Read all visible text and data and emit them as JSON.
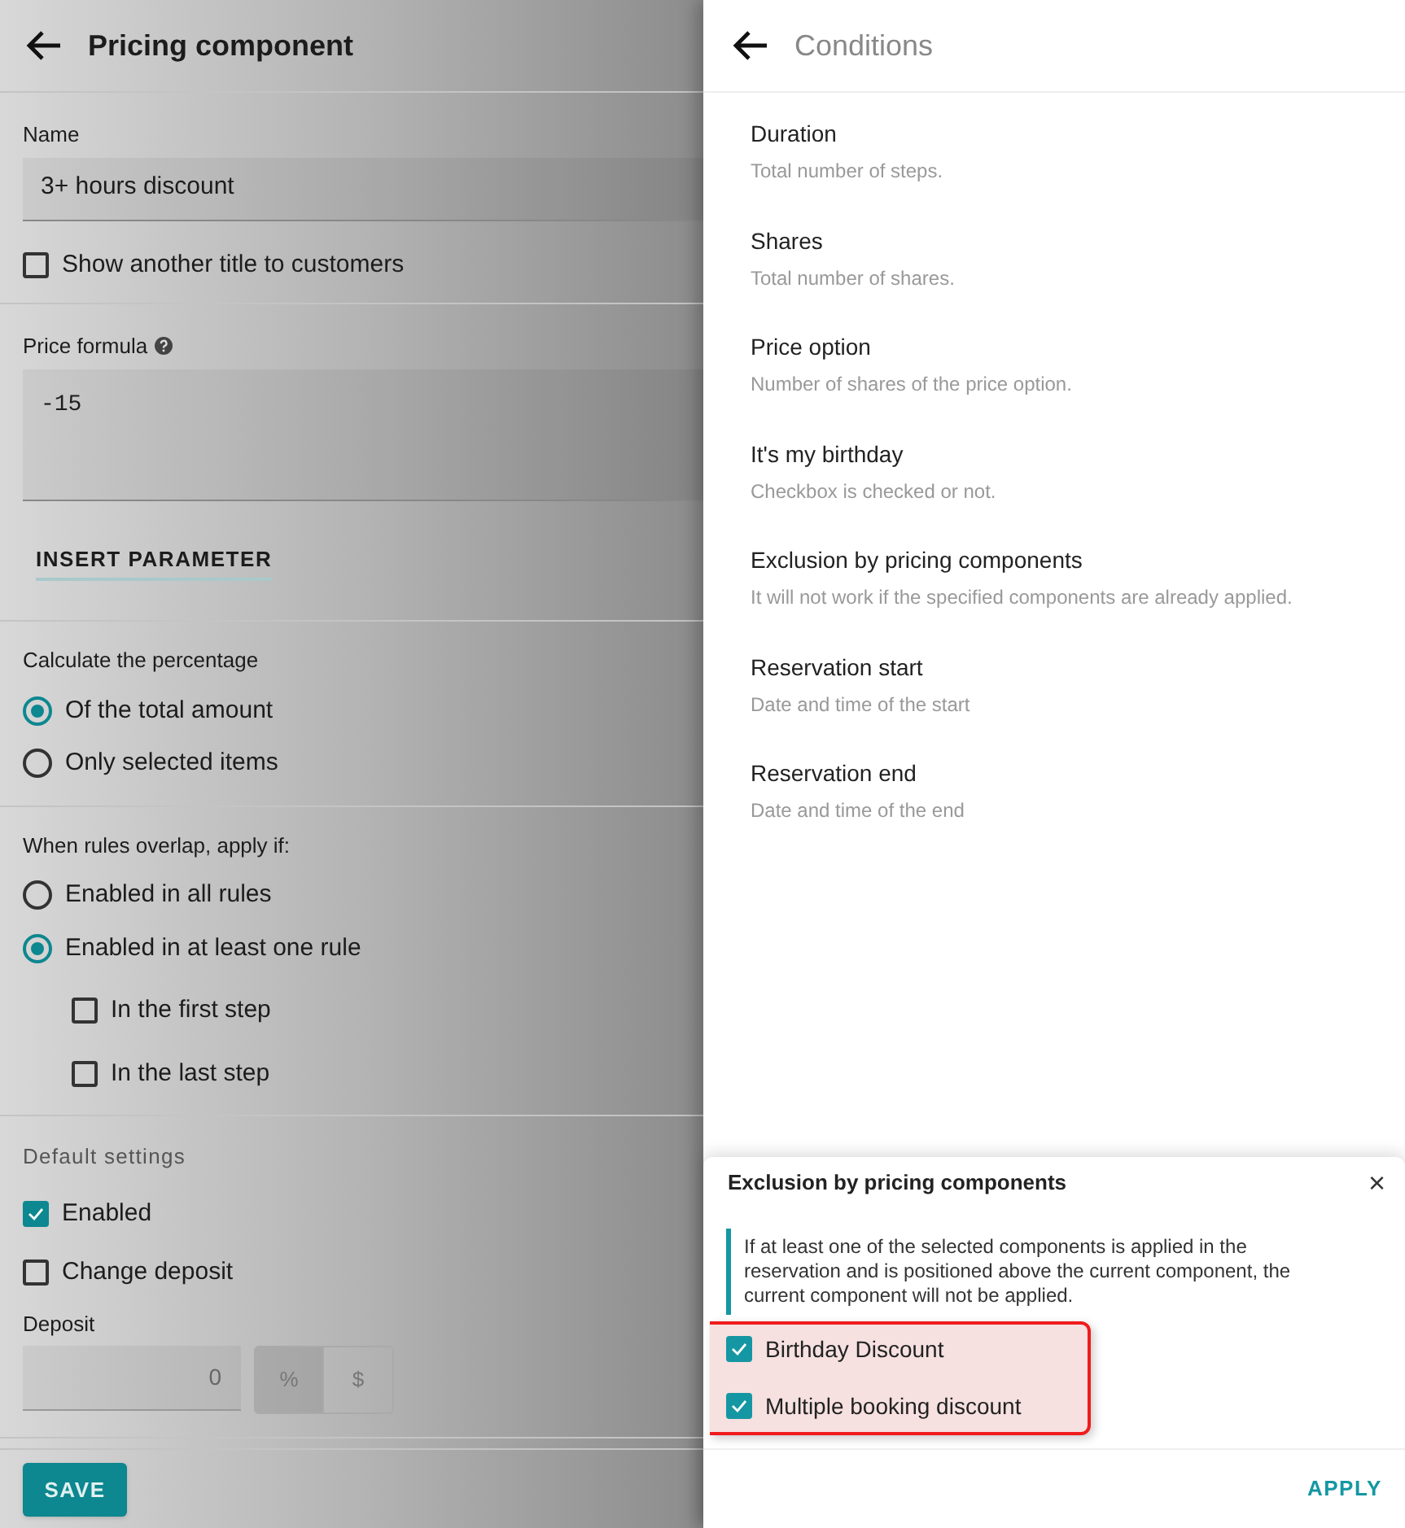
{
  "form": {
    "title": "Pricing component",
    "name_label": "Name",
    "name_value": "3+ hours discount",
    "alt_title": {
      "label": "Show another title to customers",
      "checked": false
    },
    "formula_label": "Price formula",
    "formula_value": "-15",
    "insert_button": "INSERT PARAMETER",
    "percentage": {
      "label": "Calculate the percentage",
      "options": [
        {
          "label": "Of the total amount",
          "selected": true
        },
        {
          "label": "Only selected items",
          "selected": false
        }
      ]
    },
    "overlap": {
      "label": "When rules overlap, apply if:",
      "options": [
        {
          "label": "Enabled in all rules",
          "selected": false
        },
        {
          "label": "Enabled in at least one rule",
          "selected": true
        }
      ],
      "steps": [
        {
          "label": "In the first step",
          "checked": false
        },
        {
          "label": "In the last step",
          "checked": false
        }
      ]
    },
    "defaults": {
      "heading": "Default settings",
      "checks": [
        {
          "label": "Enabled",
          "checked": true
        },
        {
          "label": "Change deposit",
          "checked": false
        }
      ],
      "deposit_label": "Deposit",
      "deposit_value": "0",
      "units": [
        {
          "label": "%",
          "selected": true
        },
        {
          "label": "$",
          "selected": false
        }
      ]
    },
    "save": "SAVE"
  },
  "conditions": {
    "title": "Conditions",
    "items": [
      {
        "title": "Duration",
        "subtitle": "Total number of steps."
      },
      {
        "title": "Shares",
        "subtitle": "Total number of shares."
      },
      {
        "title": "Price option",
        "subtitle": "Number of shares of the price option."
      },
      {
        "title": "It's my birthday",
        "subtitle": "Checkbox is checked or not."
      },
      {
        "title": "Exclusion by pricing components",
        "subtitle": "It will not work if the specified components are already applied."
      },
      {
        "title": "Reservation start",
        "subtitle": "Date and time of the start"
      },
      {
        "title": "Reservation end",
        "subtitle": "Date and time of the end"
      }
    ]
  },
  "dialog": {
    "title": "Exclusion by pricing components",
    "close": "×",
    "note": "If at least one of the selected components is applied in the reservation and is positioned above the current component, the current component will not be applied.",
    "components": [
      {
        "label": "Birthday Discount",
        "checked": true
      },
      {
        "label": "Multiple booking discount",
        "checked": true
      }
    ],
    "apply": "APPLY"
  }
}
